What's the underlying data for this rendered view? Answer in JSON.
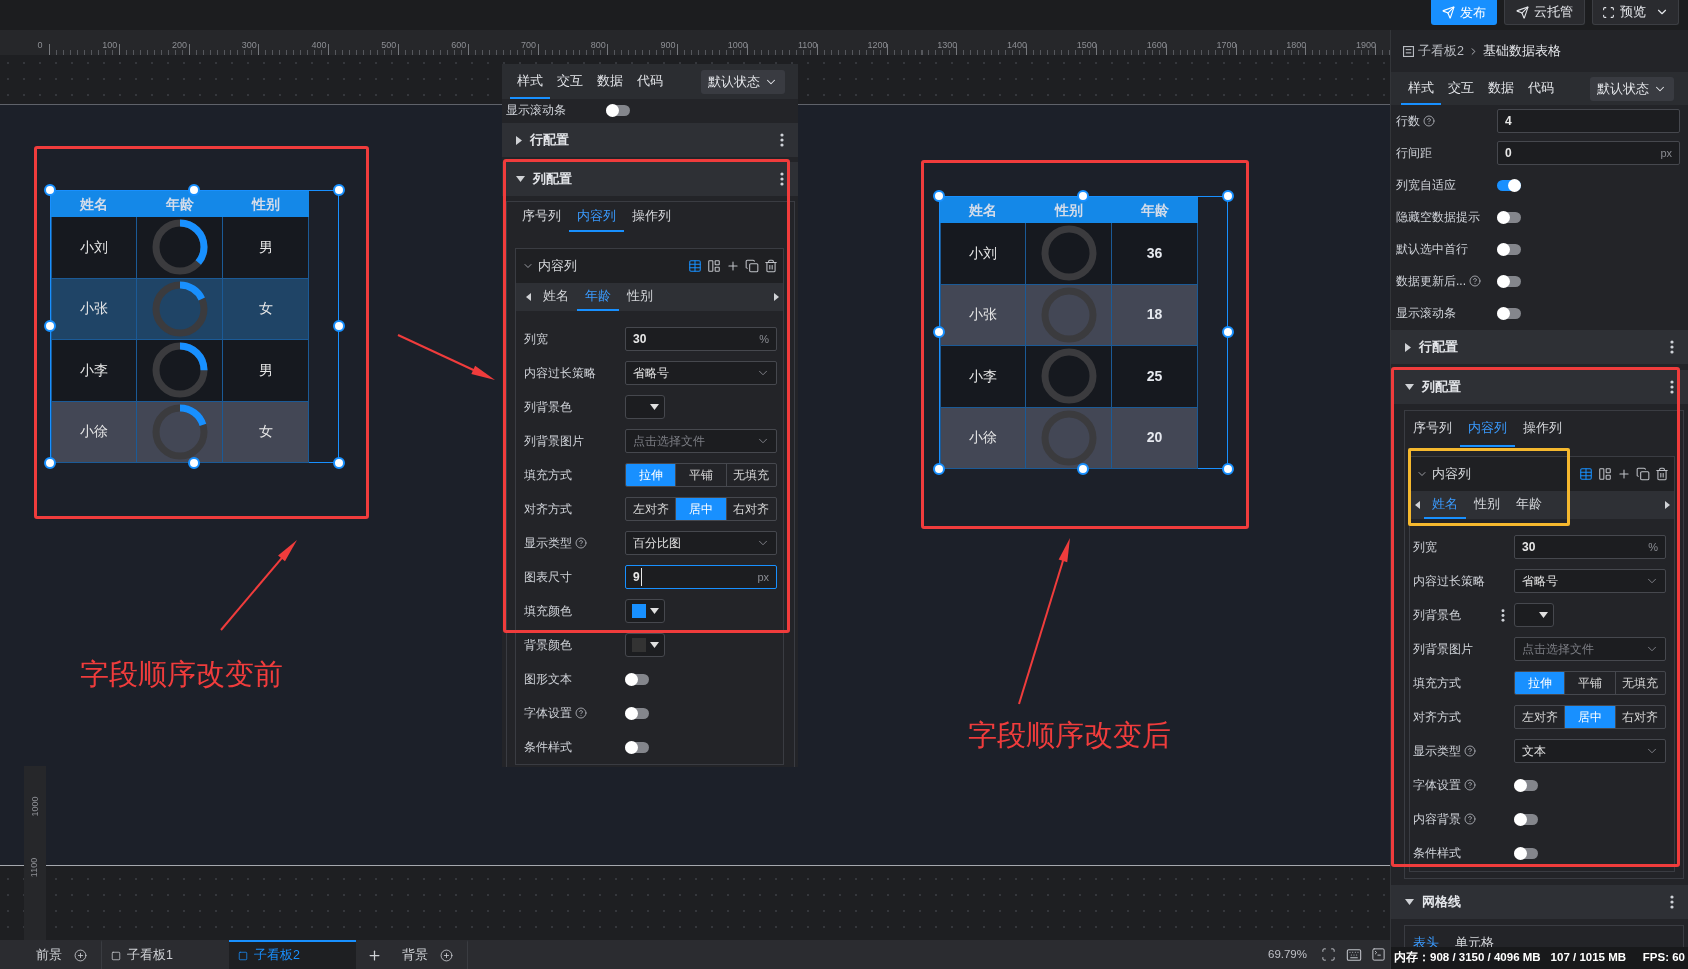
{
  "top_bar": {
    "buttons": [
      {
        "label": "发布",
        "kind": "primary"
      },
      {
        "label": "云托管",
        "kind": "cloud"
      },
      {
        "label": "预览",
        "kind": "preview"
      }
    ]
  },
  "ruler": {
    "x_labels": [
      "0",
      "100",
      "200",
      "300",
      "400",
      "500",
      "600",
      "700",
      "800",
      "900",
      "1000",
      "1100",
      "1200",
      "1300",
      "1400",
      "1500",
      "1600",
      "1700",
      "1800",
      "1900"
    ],
    "y_labels": [
      "1000",
      "1100"
    ]
  },
  "canvas": {
    "tables": [
      {
        "columns": [
          "姓名",
          "年龄",
          "性别"
        ],
        "rows": [
          {
            "highlighted": false,
            "cells": [
              {
                "kind": "text",
                "text": "小刘"
              },
              {
                "kind": "ring",
                "level": 0.36
              },
              {
                "kind": "text",
                "text": "男"
              }
            ]
          },
          {
            "highlighted": true,
            "cells": [
              {
                "kind": "text",
                "text": "小张"
              },
              {
                "kind": "ring",
                "level": 0.18
              },
              {
                "kind": "text",
                "text": "女"
              }
            ]
          },
          {
            "highlighted": false,
            "cells": [
              {
                "kind": "text",
                "text": "小李"
              },
              {
                "kind": "ring",
                "level": 0.25
              },
              {
                "kind": "text",
                "text": "男"
              }
            ]
          },
          {
            "highlighted": false,
            "cells": [
              {
                "kind": "text",
                "text": "小徐"
              },
              {
                "kind": "ring",
                "level": 0.2
              },
              {
                "kind": "text",
                "text": "女"
              }
            ]
          }
        ]
      },
      {
        "columns": [
          "姓名",
          "性别",
          "年龄"
        ],
        "rows": [
          {
            "highlighted": false,
            "cells": [
              {
                "kind": "text",
                "text": "小刘"
              },
              {
                "kind": "ring"
              },
              {
                "kind": "number",
                "text": "36"
              }
            ]
          },
          {
            "highlighted": false,
            "cells": [
              {
                "kind": "text",
                "text": "小张"
              },
              {
                "kind": "ring"
              },
              {
                "kind": "number",
                "text": "18"
              }
            ]
          },
          {
            "highlighted": false,
            "cells": [
              {
                "kind": "text",
                "text": "小李"
              },
              {
                "kind": "ring"
              },
              {
                "kind": "number",
                "text": "25"
              }
            ]
          },
          {
            "highlighted": false,
            "cells": [
              {
                "kind": "text",
                "text": "小徐"
              },
              {
                "kind": "ring"
              },
              {
                "kind": "number",
                "text": "20"
              }
            ]
          }
        ]
      }
    ],
    "annotations": [
      "字段顺序改变前",
      "字段顺序改变后"
    ]
  },
  "float_panel": {
    "tabs": [
      {
        "label": "样式",
        "selected": true
      },
      {
        "label": "交互",
        "selected": false
      },
      {
        "label": "数据",
        "selected": false
      },
      {
        "label": "代码",
        "selected": false
      }
    ],
    "state_select": "默认状态",
    "rows": [
      {
        "label": "显示滚动条",
        "help": false,
        "kind": "toggle",
        "on": false
      }
    ],
    "sections": [
      {
        "title": "行配置",
        "expanded": false
      },
      {
        "title": "列配置",
        "expanded": true,
        "tabs": [
          {
            "label": "序号列",
            "selected": false
          },
          {
            "label": "内容列",
            "selected": true
          },
          {
            "label": "操作列",
            "selected": false
          }
        ],
        "group": {
          "title": "内容列",
          "expanded": true,
          "tools": [
            {
              "kind": "table",
              "active": true
            },
            {
              "kind": "split",
              "active": false
            },
            {
              "kind": "add",
              "active": false
            },
            {
              "kind": "copy",
              "active": false
            },
            {
              "kind": "delete",
              "active": false
            }
          ],
          "fields": [
            {
              "label": "姓名",
              "selected": false
            },
            {
              "label": "年龄",
              "selected": true
            },
            {
              "label": "性别",
              "selected": false
            }
          ],
          "rows": [
            {
              "label": "列宽",
              "help": false,
              "kind": "input",
              "value": "30",
              "unit": "%",
              "focused": false
            },
            {
              "label": "内容过长策略",
              "help": false,
              "kind": "select",
              "value": "省略号"
            },
            {
              "label": "列背景色",
              "help": false,
              "kind": "color",
              "handle": false
            },
            {
              "label": "列背景图片",
              "help": false,
              "kind": "select",
              "placeholder": "点击选择文件"
            },
            {
              "label": "填充方式",
              "help": false,
              "kind": "segmented",
              "options": [
                {
                  "label": "拉伸",
                  "selected": true
                },
                {
                  "label": "平铺",
                  "selected": false
                },
                {
                  "label": "无填充",
                  "selected": false
                }
              ]
            },
            {
              "label": "对齐方式",
              "help": false,
              "kind": "segmented",
              "options": [
                {
                  "label": "左对齐",
                  "selected": false
                },
                {
                  "label": "居中",
                  "selected": true
                },
                {
                  "label": "右对齐",
                  "selected": false
                }
              ]
            },
            {
              "label": "显示类型",
              "help": true,
              "kind": "select",
              "value": "百分比图"
            },
            {
              "label": "图表尺寸",
              "help": false,
              "kind": "input",
              "value": "9",
              "unit": "px",
              "focused": true
            },
            {
              "label": "填充颜色",
              "help": false,
              "kind": "color",
              "color": "#1890ff",
              "handle": false
            },
            {
              "label": "背景颜色",
              "help": false,
              "kind": "color",
              "color": "#333333",
              "handle": false
            },
            {
              "label": "图形文本",
              "help": false,
              "kind": "toggle",
              "on": false
            },
            {
              "label": "字体设置",
              "help": true,
              "kind": "toggle",
              "on": false
            },
            {
              "label": "条件样式",
              "help": false,
              "kind": "toggle",
              "on": false
            }
          ]
        }
      }
    ]
  },
  "side_panel": {
    "breadcrumb": [
      "子看板2",
      "基础数据表格"
    ],
    "tabs": [
      {
        "label": "样式",
        "selected": true
      },
      {
        "label": "交互",
        "selected": false
      },
      {
        "label": "数据",
        "selected": false
      },
      {
        "label": "代码",
        "selected": false
      }
    ],
    "state_select": "默认状态",
    "rows": [
      {
        "label": "行数",
        "help": true,
        "kind": "input",
        "value": "4",
        "focused": false
      },
      {
        "label": "行间距",
        "help": false,
        "kind": "input",
        "value": "0",
        "unit": "px",
        "focused": false
      },
      {
        "label": "列宽自适应",
        "help": false,
        "kind": "toggle",
        "on": true
      },
      {
        "label": "隐藏空数据提示",
        "help": false,
        "kind": "toggle",
        "on": false
      },
      {
        "label": "默认选中首行",
        "help": false,
        "kind": "toggle",
        "on": false
      },
      {
        "label": "数据更新后...",
        "help": true,
        "kind": "toggle",
        "on": false
      },
      {
        "label": "显示滚动条",
        "help": false,
        "kind": "toggle",
        "on": false
      }
    ],
    "sections": [
      {
        "title": "行配置",
        "expanded": false
      },
      {
        "title": "列配置",
        "expanded": true,
        "tabs": [
          {
            "label": "序号列",
            "selected": false
          },
          {
            "label": "内容列",
            "selected": true
          },
          {
            "label": "操作列",
            "selected": false
          }
        ],
        "group": {
          "title": "内容列",
          "expanded": true,
          "tools": [
            {
              "kind": "table",
              "active": true
            },
            {
              "kind": "split",
              "active": false
            },
            {
              "kind": "add",
              "active": false
            },
            {
              "kind": "copy",
              "active": false
            },
            {
              "kind": "delete",
              "active": false
            }
          ],
          "fields": [
            {
              "label": "姓名",
              "selected": true
            },
            {
              "label": "性别",
              "selected": false
            },
            {
              "label": "年龄",
              "selected": false
            }
          ],
          "rows": [
            {
              "label": "列宽",
              "help": false,
              "kind": "input",
              "value": "30",
              "unit": "%",
              "focused": false
            },
            {
              "label": "内容过长策略",
              "help": false,
              "kind": "select",
              "value": "省略号"
            },
            {
              "label": "列背景色",
              "help": false,
              "kind": "color",
              "handle": true
            },
            {
              "label": "列背景图片",
              "help": false,
              "kind": "select",
              "placeholder": "点击选择文件"
            },
            {
              "label": "填充方式",
              "help": false,
              "kind": "segmented",
              "options": [
                {
                  "label": "拉伸",
                  "selected": true
                },
                {
                  "label": "平铺",
                  "selected": false
                },
                {
                  "label": "无填充",
                  "selected": false
                }
              ]
            },
            {
              "label": "对齐方式",
              "help": false,
              "kind": "segmented",
              "options": [
                {
                  "label": "左对齐",
                  "selected": false
                },
                {
                  "label": "居中",
                  "selected": true
                },
                {
                  "label": "右对齐",
                  "selected": false
                }
              ]
            },
            {
              "label": "显示类型",
              "help": true,
              "kind": "select",
              "value": "文本"
            },
            {
              "label": "字体设置",
              "help": true,
              "kind": "toggle",
              "on": false
            },
            {
              "label": "内容背景",
              "help": true,
              "kind": "toggle",
              "on": false
            },
            {
              "label": "条件样式",
              "help": false,
              "kind": "toggle",
              "on": false
            }
          ]
        }
      },
      {
        "title": "网格线",
        "expanded": true,
        "tabs": [
          {
            "label": "表头",
            "selected": true
          },
          {
            "label": "单元格",
            "selected": false
          }
        ]
      }
    ]
  },
  "bottom_bar": {
    "tabs": [
      {
        "label": "前景",
        "kind": "layer",
        "selected": false
      },
      {
        "label": "子看板1",
        "kind": "board",
        "selected": false
      },
      {
        "label": "子看板2",
        "kind": "board",
        "selected": true
      },
      {
        "kind": "add",
        "selected": false
      },
      {
        "label": "背景",
        "kind": "layer",
        "selected": false
      }
    ],
    "zoom": "69.79%"
  },
  "status_bar": {
    "items": [
      "内存：908 / 3150 / 4096 MB",
      "107 / 1015 MB",
      "FPS: 60"
    ]
  }
}
